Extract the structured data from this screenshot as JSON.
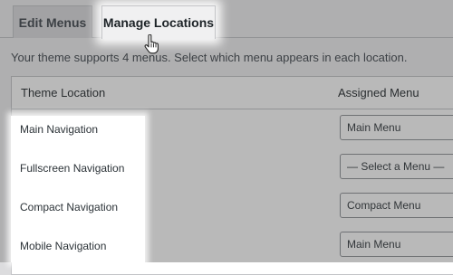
{
  "tabs": [
    {
      "label": "Edit Menus",
      "active": false
    },
    {
      "label": "Manage Locations",
      "active": true
    }
  ],
  "intro_text": "Your theme supports 4 menus. Select which menu appears in each location.",
  "table": {
    "headers": {
      "location": "Theme Location",
      "menu": "Assigned Menu"
    },
    "rows": [
      {
        "location": "Main Navigation",
        "menu": "Main Menu"
      },
      {
        "location": "Fullscreen Navigation",
        "menu": "— Select a Menu —"
      },
      {
        "location": "Compact Navigation",
        "menu": "Compact Menu"
      },
      {
        "location": "Mobile Navigation",
        "menu": "Main Menu"
      }
    ]
  },
  "colors": {
    "background": "#f0f0f1",
    "border": "#c3c4c7",
    "text": "#1d2327"
  },
  "icons": {
    "cursor": "hand-pointer-icon"
  }
}
